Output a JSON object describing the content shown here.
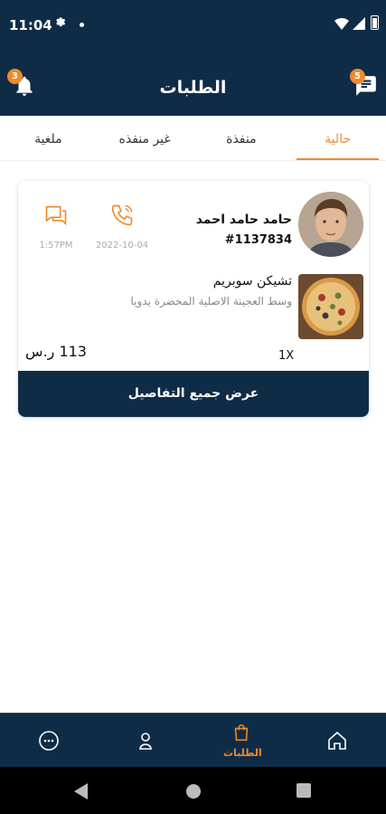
{
  "status_bar": {
    "time": "11:04"
  },
  "header": {
    "title": "الطلبات",
    "notification_count": "3",
    "message_count": "5"
  },
  "tabs": [
    {
      "label": "حالية",
      "active": true
    },
    {
      "label": "منفذة",
      "active": false
    },
    {
      "label": "غير منفذه",
      "active": false
    },
    {
      "label": "ملغية",
      "active": false
    }
  ],
  "order": {
    "customer_name": "حامد حامد احمد",
    "order_number": "#1137834",
    "call_date": "2022-10-04",
    "message_time": "1:57PM",
    "item_name": "تشيكن سوبريم",
    "item_description": "وسط العجينة الاصلية المحضرة يدويا",
    "quantity": "1X",
    "price": "113 ر.س",
    "details_button": "عرض جميع التفاصيل"
  },
  "bottom_nav": {
    "orders_label": "الطلبات"
  },
  "colors": {
    "primary": "#0f2c47",
    "accent": "#ef8a2d"
  }
}
